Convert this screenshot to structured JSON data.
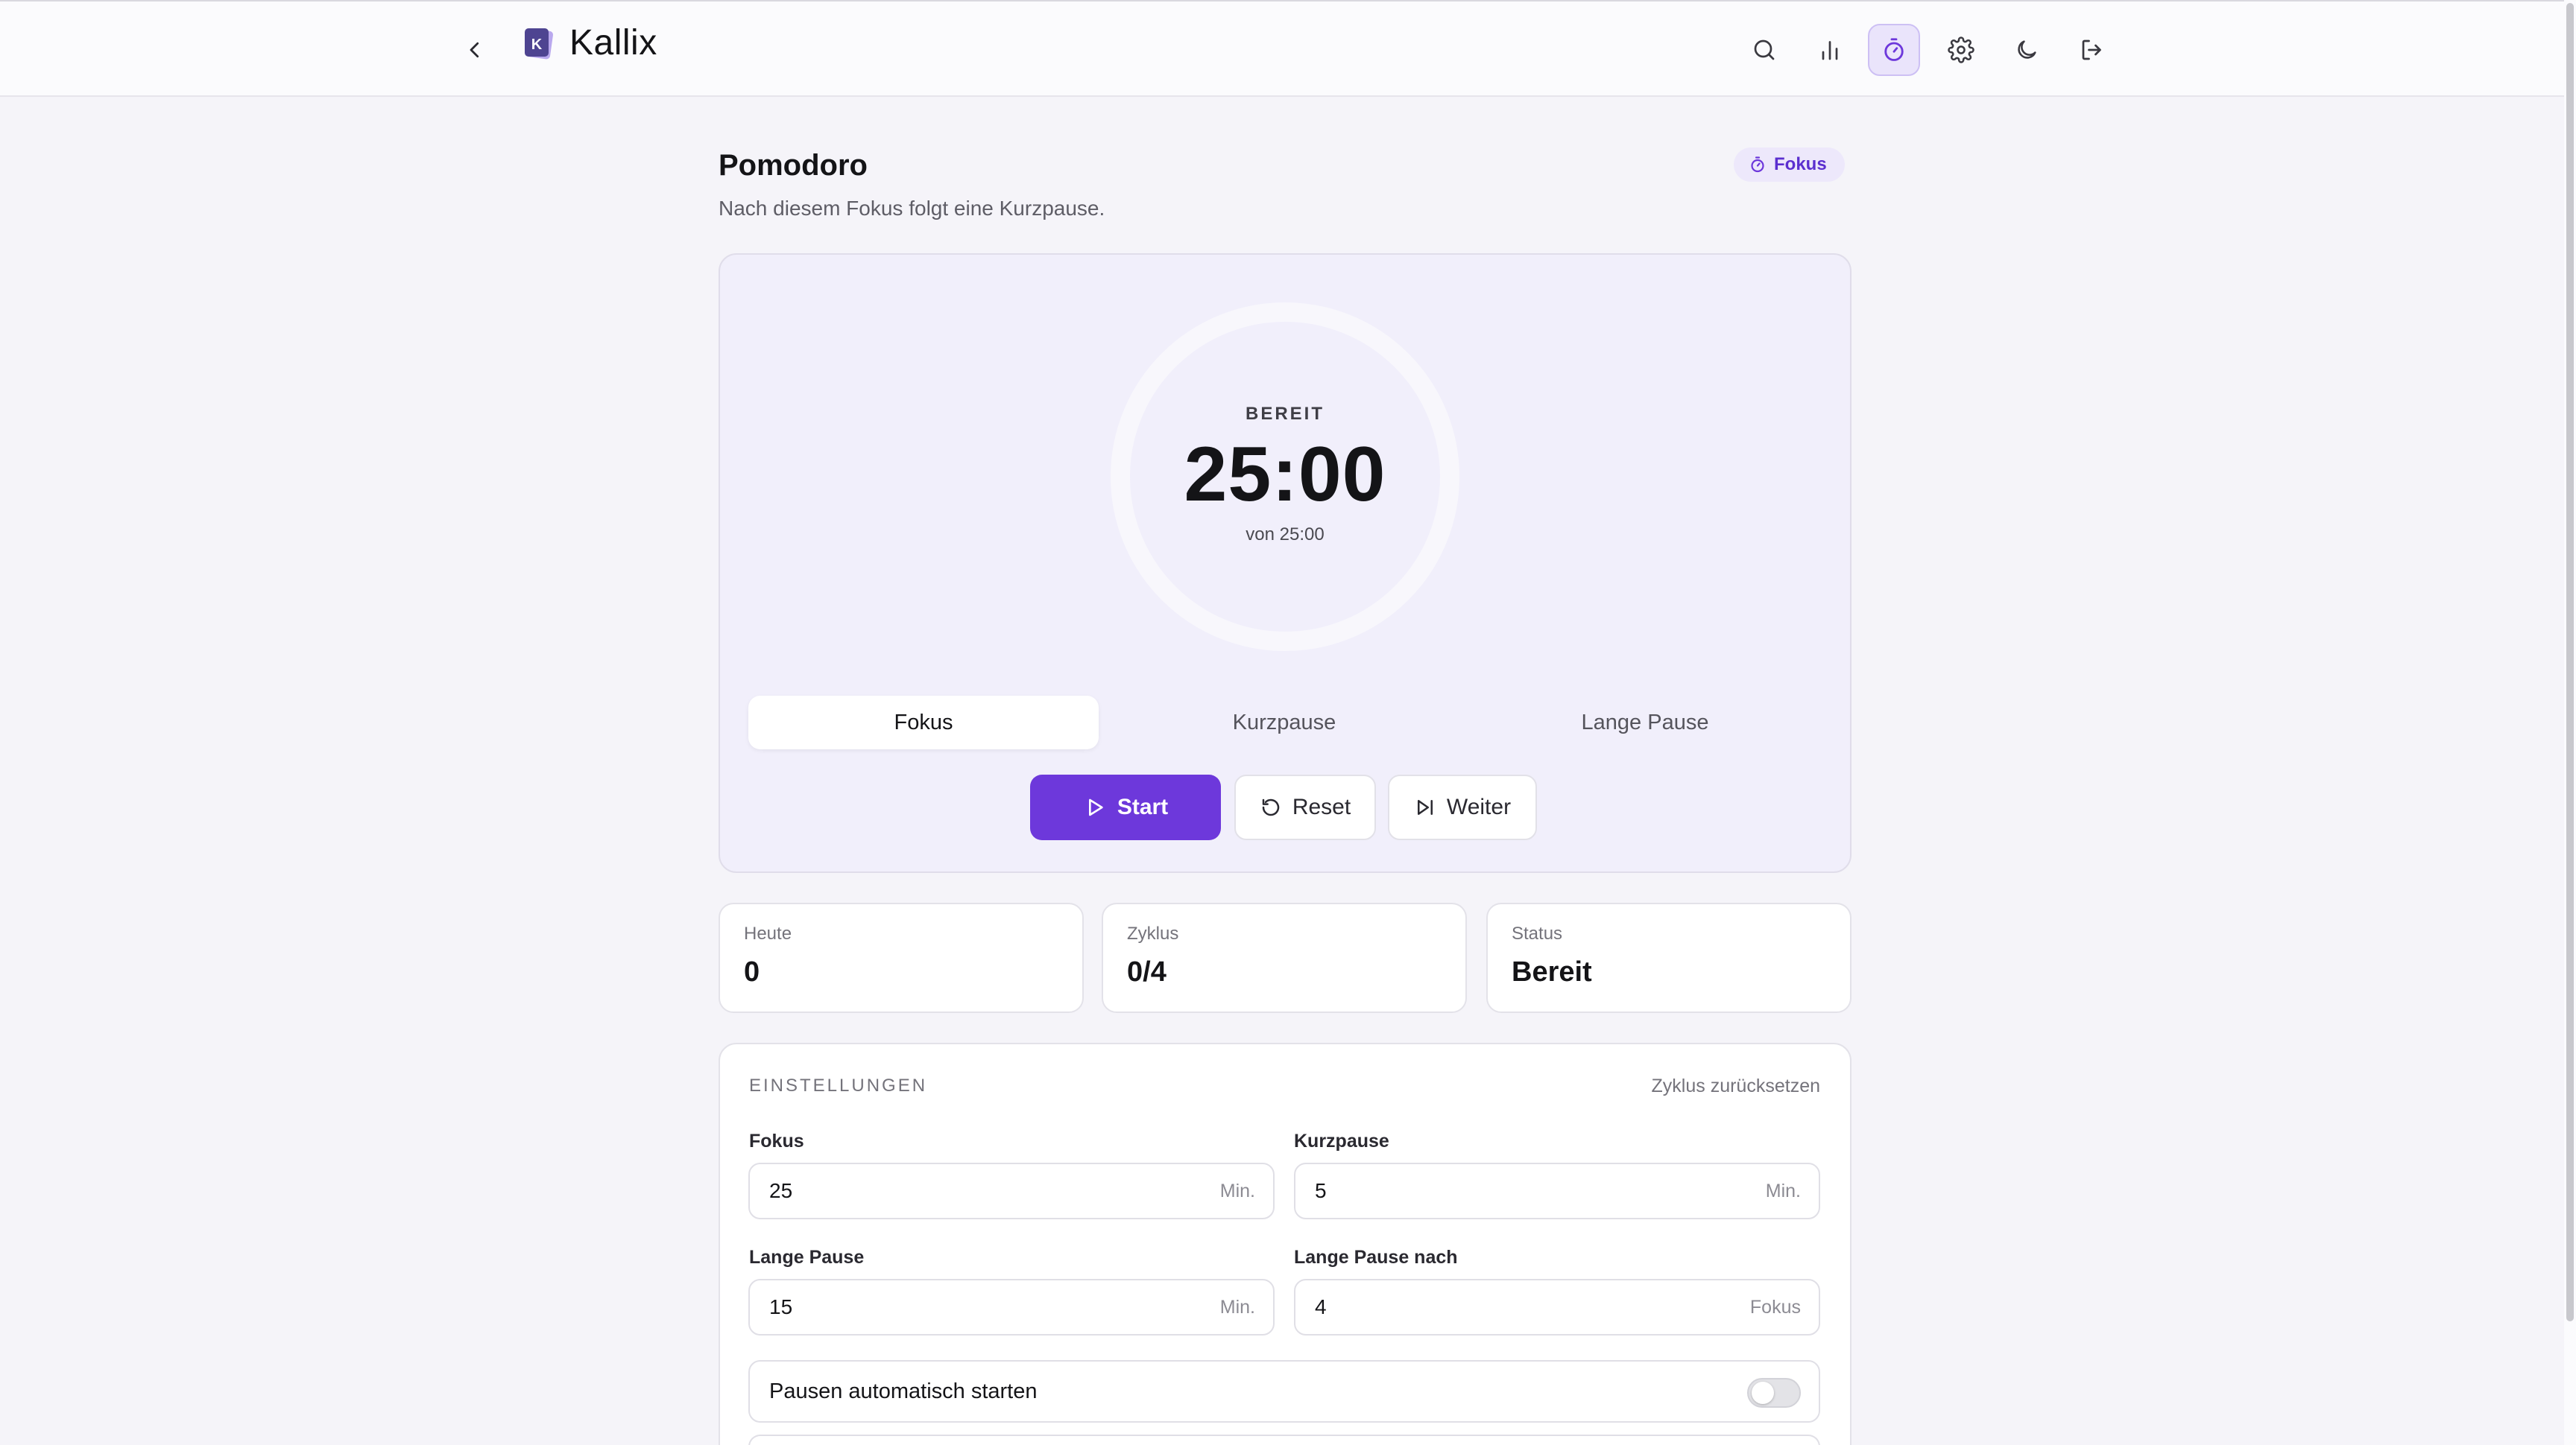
{
  "header": {
    "brand": "Kallix",
    "logo_letter": "K",
    "icons": [
      "search-icon",
      "stats-icon",
      "timer-icon",
      "gear-icon",
      "moon-icon",
      "logout-icon"
    ],
    "active_icon": "timer-icon"
  },
  "page": {
    "title": "Pomodoro",
    "subtitle": "Nach diesem Fokus folgt eine Kurzpause.",
    "badge": "Fokus"
  },
  "timer": {
    "state": "BEREIT",
    "time": "25:00",
    "of": "von 25:00",
    "progress": 0
  },
  "modes": [
    {
      "label": "Fokus",
      "active": true
    },
    {
      "label": "Kurzpause",
      "active": false
    },
    {
      "label": "Lange Pause",
      "active": false
    }
  ],
  "controls": {
    "start": "Start",
    "reset": "Reset",
    "next": "Weiter"
  },
  "stats": [
    {
      "label": "Heute",
      "value": "0"
    },
    {
      "label": "Zyklus",
      "value": "0/4"
    },
    {
      "label": "Status",
      "value": "Bereit"
    }
  ],
  "settings": {
    "title": "EINSTELLUNGEN",
    "reset_cycle": "Zyklus zurücksetzen",
    "fields": [
      {
        "label": "Fokus",
        "value": "25",
        "unit": "Min."
      },
      {
        "label": "Kurzpause",
        "value": "5",
        "unit": "Min."
      },
      {
        "label": "Lange Pause",
        "value": "15",
        "unit": "Min."
      },
      {
        "label": "Lange Pause nach",
        "value": "4",
        "unit": "Fokus"
      }
    ],
    "auto_start_label": "Pausen automatisch starten",
    "auto_start_enabled": false
  },
  "colors": {
    "accent": "#6D38DB",
    "badge_bg": "#EDE8FB",
    "card_tint": "#F1EFFB"
  }
}
